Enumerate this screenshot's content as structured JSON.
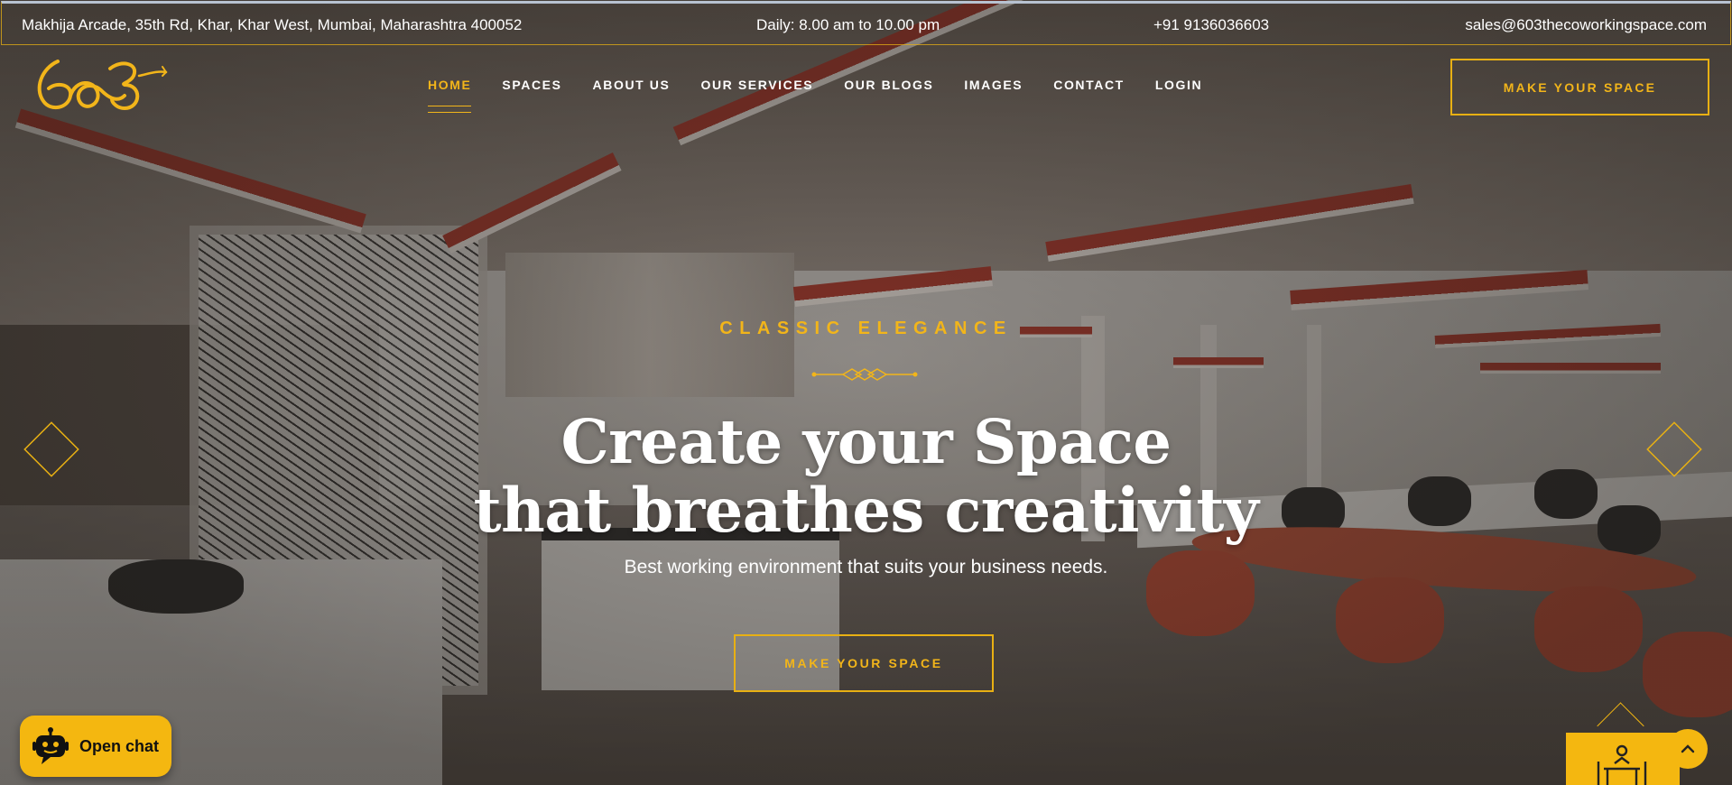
{
  "topbar": {
    "address": "Makhija Arcade, 35th Rd, Khar, Khar West, Mumbai, Maharashtra 400052",
    "hours": "Daily: 8.00 am to 10.00 pm",
    "phone": "+91 9136036603",
    "email": "sales@603thecoworkingspace.com"
  },
  "logo": {
    "text": "603"
  },
  "nav": {
    "items": [
      {
        "label": "HOME",
        "active": true
      },
      {
        "label": "SPACES"
      },
      {
        "label": "ABOUT US"
      },
      {
        "label": "OUR SERVICES"
      },
      {
        "label": "OUR BLOGS"
      },
      {
        "label": "IMAGES"
      },
      {
        "label": "CONTACT"
      },
      {
        "label": "LOGIN"
      }
    ],
    "cta_label": "MAKE YOUR SPACE"
  },
  "hero": {
    "eyebrow": "CLASSIC ELEGANCE",
    "headline_line1": "Create your Space",
    "headline_line2": "that breathes creativity",
    "subline": "Best working environment that suits your business needs.",
    "cta_label": "MAKE YOUR SPACE",
    "prev_icon": "diamond-left-arrow-icon",
    "next_icon": "diamond-right-arrow-icon"
  },
  "chat": {
    "label": "Open chat",
    "icon": "robot-icon"
  },
  "widgets": {
    "badge_icon": "meeting-desk-icon",
    "scroll_top_icon": "chevron-up-icon"
  },
  "colors": {
    "accent": "#f2b51a",
    "accent_dark": "#e8b013",
    "text": "#ffffff"
  }
}
